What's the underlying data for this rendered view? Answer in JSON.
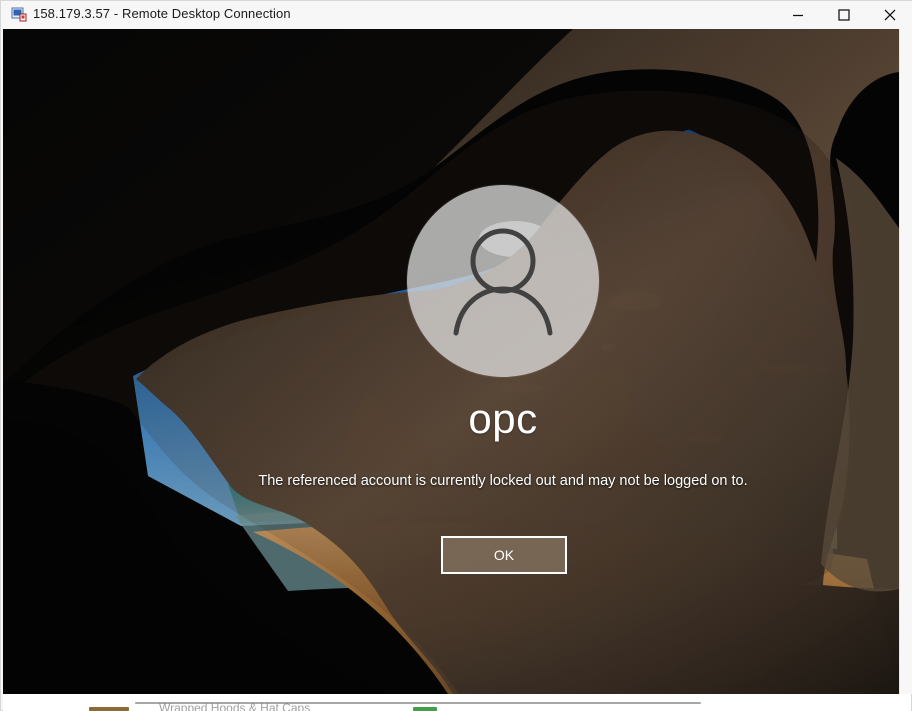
{
  "window": {
    "title": "158.179.3.57 - Remote Desktop Connection"
  },
  "icons": {
    "app": "remote-desktop-icon",
    "minimize": "minimize-icon",
    "maximize": "maximize-icon",
    "close": "close-icon",
    "user": "user-avatar-icon"
  },
  "lock_screen": {
    "username": "opc",
    "message": "The referenced account is currently locked out and may not be logged on to.",
    "ok_label": "OK"
  },
  "taskbar_fragment": {
    "text": "Wrapped Hoods & Hat Caps"
  },
  "colors": {
    "button_fill": "#857360",
    "sky": "#1f67ad",
    "sand": "#a9743c",
    "cave": "#070707"
  }
}
